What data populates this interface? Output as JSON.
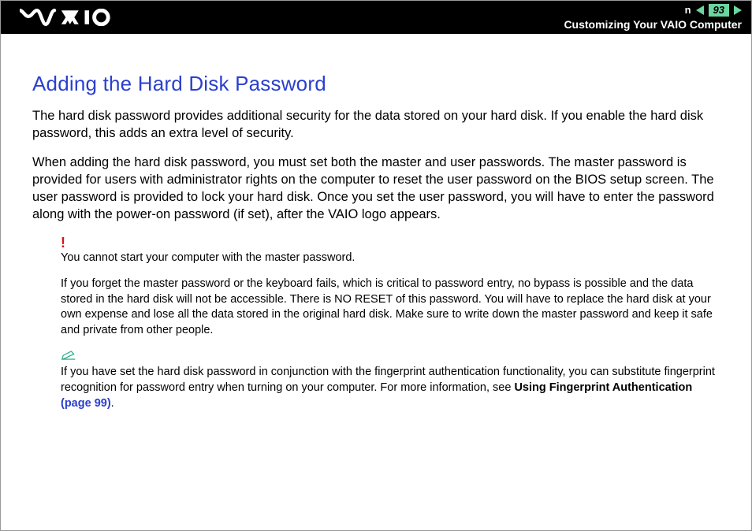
{
  "header": {
    "page_number": "93",
    "section_title": "Customizing Your VAIO Computer",
    "n_label": "n"
  },
  "content": {
    "heading": "Adding the Hard Disk Password",
    "para1": "The hard disk password provides additional security for the data stored on your hard disk. If you enable the hard disk password, this adds an extra level of security.",
    "para2": "When adding the hard disk password, you must set both the master and user passwords. The master password is provided for users with administrator rights on the computer to reset the user password on the BIOS setup screen. The user password is provided to lock your hard disk. Once you set the user password, you will have to enter the password along with the power-on password (if set), after the VAIO logo appears.",
    "warn1": "You cannot start your computer with the master password.",
    "warn2": "If you forget the master password or the keyboard fails, which is critical to password entry, no bypass is possible and the data stored in the hard disk will not be accessible. There is NO RESET of this password. You will have to replace the hard disk at your own expense and lose all the data stored in the original hard disk. Make sure to write down the master password and keep it safe and private from other people.",
    "tip_pre": "If you have set the hard disk password in conjunction with the fingerprint authentication functionality, you can substitute fingerprint recognition for password entry when turning on your computer. For more information, see ",
    "tip_bold": "Using Fingerprint Authentication ",
    "tip_link": "(page 99)",
    "tip_post": "."
  }
}
